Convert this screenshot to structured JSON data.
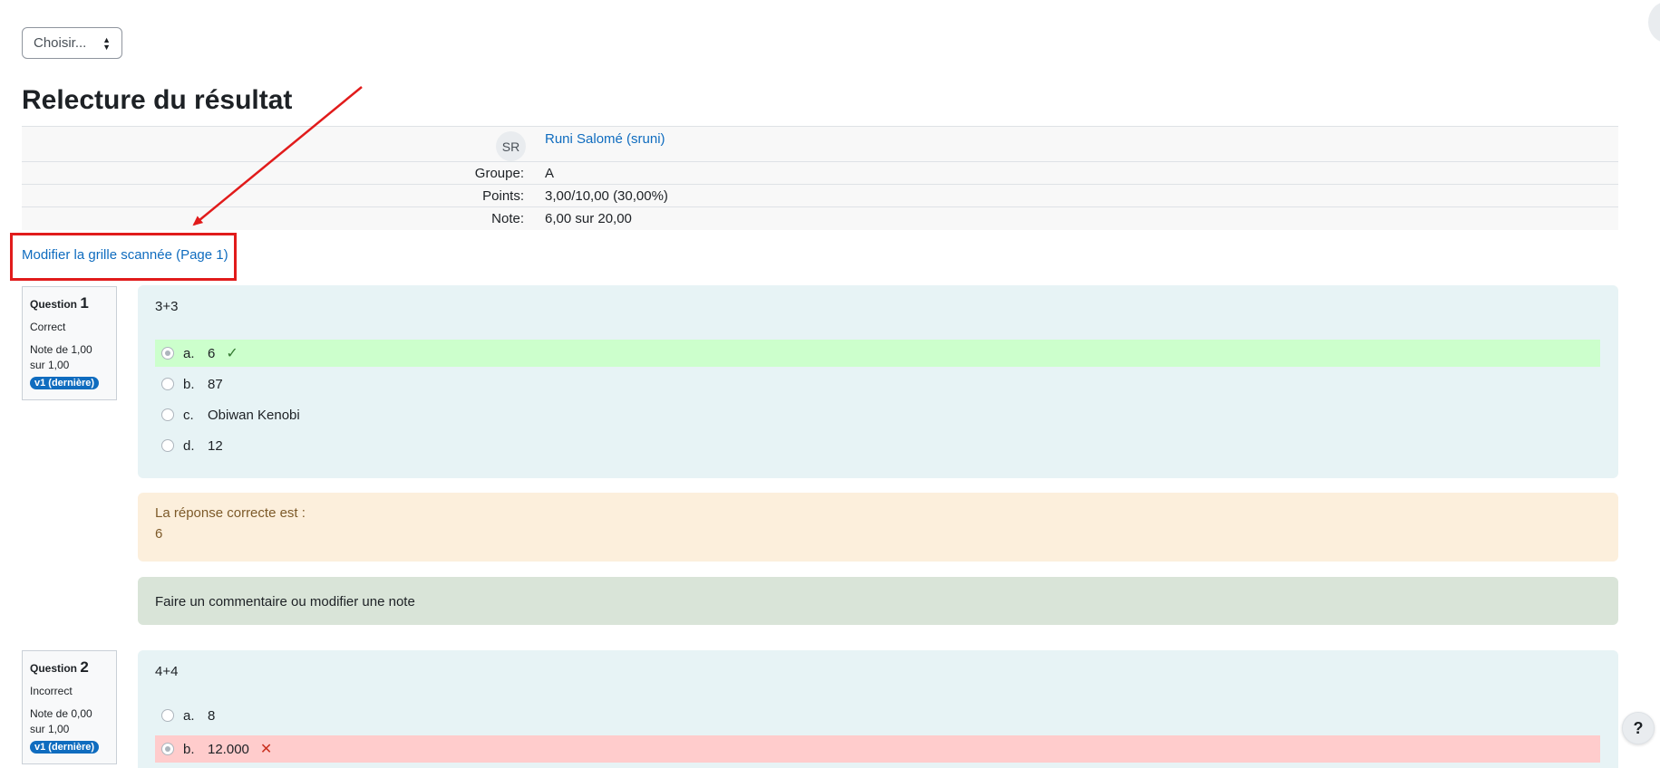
{
  "nav": {
    "select_value": "Choisir..."
  },
  "page_title": "Relecture du résultat",
  "summary": {
    "avatar_initials": "SR",
    "user_name": "Runi Salomé (sruni)",
    "rows": [
      {
        "label": "Groupe:",
        "value": "A"
      },
      {
        "label": "Points:",
        "value": "3,00/10,00 (30,00%)"
      },
      {
        "label": "Note:",
        "value": "6,00 sur 20,00"
      }
    ]
  },
  "edit_link": "Modifier la grille scannée (Page 1)",
  "annotation": {
    "color": "#e11b1b"
  },
  "questions": [
    {
      "label": "Question",
      "number": "1",
      "state": "Correct",
      "grade": "Note de 1,00 sur 1,00",
      "version": "v1 (dernière)",
      "text": "3+3",
      "answers": [
        {
          "letter": "a.",
          "text": "6",
          "selected": true,
          "status": "correct"
        },
        {
          "letter": "b.",
          "text": "87"
        },
        {
          "letter": "c.",
          "text": "Obiwan Kenobi"
        },
        {
          "letter": "d.",
          "text": "12"
        }
      ],
      "feedback_heading": "La réponse correcte est :",
      "feedback_answer": "6",
      "comment_link": "Faire un commentaire ou modifier une note"
    },
    {
      "label": "Question",
      "number": "2",
      "state": "Incorrect",
      "grade": "Note de 0,00 sur 1,00",
      "version": "v1 (dernière)",
      "text": "4+4",
      "answers": [
        {
          "letter": "a.",
          "text": "8"
        },
        {
          "letter": "b.",
          "text": "12.000",
          "selected": true,
          "status": "incorrect"
        }
      ]
    }
  ],
  "help_label": "?",
  "colors": {
    "link": "#0f6cbf",
    "correct_bg": "#ccffcc",
    "incorrect_bg": "#ffcccc",
    "formulation_bg": "#e7f3f5",
    "feedback_bg": "#fcefdc",
    "comment_bg": "#d9e4d8",
    "badge_bg": "#0f6cbf"
  }
}
